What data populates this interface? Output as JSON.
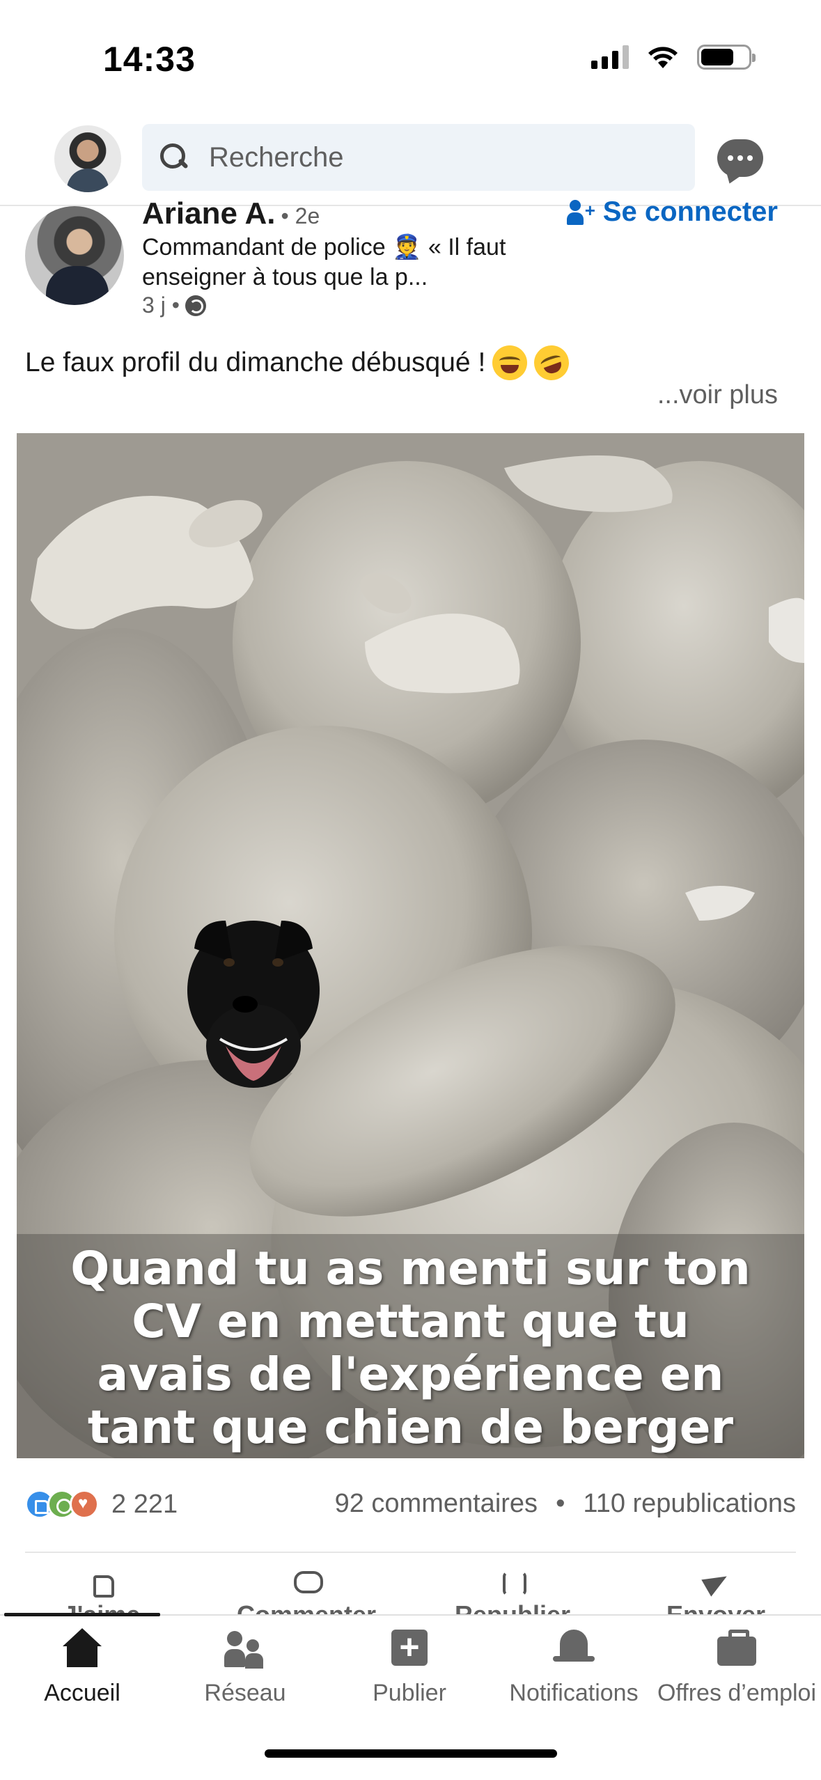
{
  "status_bar": {
    "time": "14:33"
  },
  "header": {
    "search_placeholder": "Recherche"
  },
  "post": {
    "author": {
      "name": "Ariane A.",
      "degree": "• 2e",
      "headline": "Commandant de police 👮 « Il faut enseigner à tous que la p...",
      "meta_time": "3 j •"
    },
    "connect_label": "Se connecter",
    "text": "Le faux profil du dimanche débusqué !",
    "see_more": "...voir plus",
    "image_caption": "Quand tu as menti sur ton CV en mettant que tu avais de l'expérience en tant que chien de berger",
    "reaction_count": "2 221",
    "comments": "92 commentaires",
    "separator": "•",
    "reposts": "110 republications",
    "actions": [
      "J'aime",
      "Commenter",
      "Republier",
      "Envoyer"
    ]
  },
  "bottom_nav": {
    "items": [
      {
        "label": "Accueil",
        "icon": "home-icon",
        "active": true
      },
      {
        "label": "Réseau",
        "icon": "network-icon",
        "active": false
      },
      {
        "label": "Publier",
        "icon": "add-post-icon",
        "active": false
      },
      {
        "label": "Notifications",
        "icon": "bell-icon",
        "active": false
      },
      {
        "label": "Offres d’emploi",
        "icon": "briefcase-icon",
        "active": false
      }
    ]
  },
  "colors": {
    "brand_blue": "#0a66c2",
    "text_primary": "#191919",
    "text_secondary": "#5f5f5f",
    "search_bg": "#eef3f8"
  }
}
